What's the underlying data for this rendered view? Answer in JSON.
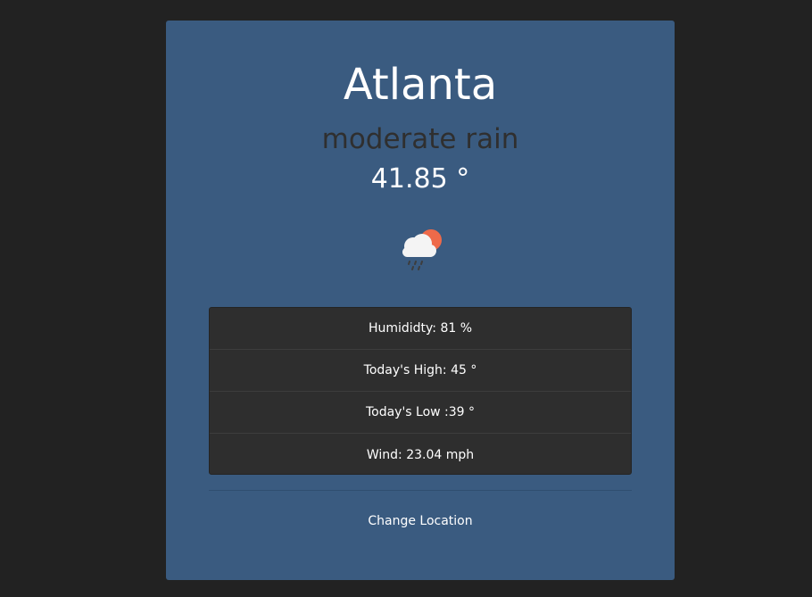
{
  "weather": {
    "city": "Atlanta",
    "condition": "moderate rain",
    "temperature": "41.85 °",
    "icon": "rain-cloud-sun-icon"
  },
  "details": [
    {
      "text": "Humididty: 81 %"
    },
    {
      "text": "Today's High: 45 °"
    },
    {
      "text": "Today's Low :39 °"
    },
    {
      "text": "Wind: 23.04 mph"
    }
  ],
  "actions": {
    "change_location": "Change Location"
  },
  "colors": {
    "background": "#222222",
    "card": "#3a5b80",
    "panel": "#2e2e2e",
    "sun": "#ee6a4a",
    "cloud": "#f4f4f4"
  }
}
